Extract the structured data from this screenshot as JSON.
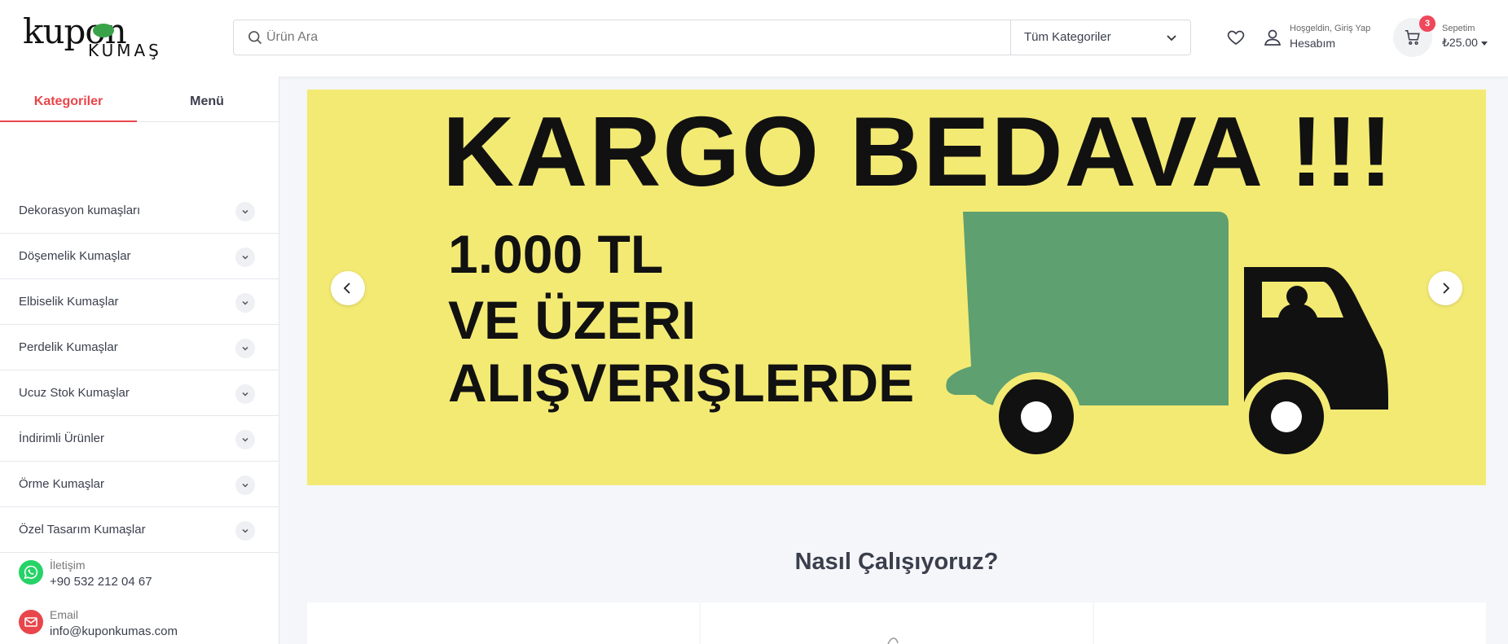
{
  "header": {
    "logo_top": "kupon",
    "logo_bottom": "KUMAŞ",
    "search_placeholder": "Ürün Ara",
    "category_select": "Tüm Kategoriler",
    "account_greeting": "Hoşgeldin, Giriş Yap",
    "account_label": "Hesabım",
    "cart_count": "3",
    "cart_label": "Sepetim",
    "cart_total": "₺25.00"
  },
  "sidebar": {
    "tabs": [
      {
        "label": "Kategoriler",
        "active": true
      },
      {
        "label": "Menü",
        "active": false
      }
    ],
    "categories": [
      "Dekorasyon kumaşları",
      "Döşemelik Kumaşlar",
      "Elbiselik Kumaşlar",
      "Perdelik Kumaşlar",
      "Ucuz Stok Kumaşlar",
      "İndirimli Ürünler",
      "Örme Kumaşlar",
      "Özel Tasarım Kumaşlar"
    ],
    "contacts": [
      {
        "label": "İletişim",
        "value": "+90 532 212 04 67",
        "icon": "whatsapp-icon",
        "color": "#25d366"
      },
      {
        "label": "Email",
        "value": "info@kuponkumas.com",
        "icon": "email-icon",
        "color": "#e8464b"
      }
    ]
  },
  "banner": {
    "headline": "KARGO  BEDAVA !!!",
    "line1": "1.000 TL",
    "line2": "VE ÜZERI",
    "line3": "ALIŞVERIŞLERDE",
    "background": "#f3ea74",
    "truck_color": "#5ea06f"
  },
  "main": {
    "section_title": "Nasıl Çalışıyoruz?"
  },
  "colors": {
    "accent": "#e8464b",
    "badge": "#f0475b"
  }
}
